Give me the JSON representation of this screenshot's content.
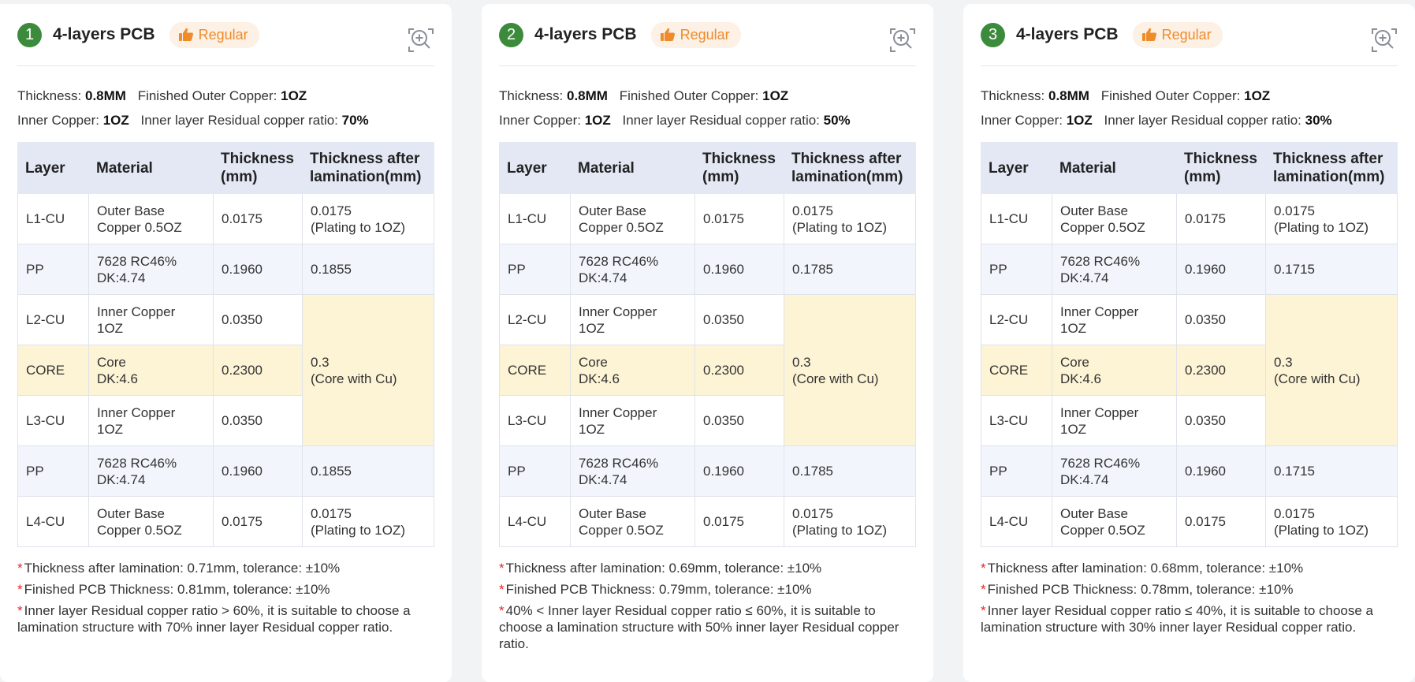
{
  "cards": [
    {
      "number": "1",
      "title": "4-layers PCB",
      "tag": "Regular",
      "specs": {
        "thickness_label": "Thickness:",
        "thickness": "0.8MM",
        "outer_label": "Finished Outer Copper:",
        "outer": "1OZ",
        "inner_label": "Inner Copper:",
        "inner": "1OZ",
        "ratio_label": "Inner layer Residual copper ratio:",
        "ratio": "70%"
      },
      "headers": [
        "Layer",
        "Material",
        "Thickness (mm)",
        "Thickness after lamination(mm)"
      ],
      "rows": [
        {
          "layer": "L1-CU",
          "material": "Outer Base Copper 0.5OZ",
          "thickness": "0.0175",
          "after": "0.0175\n(Plating to 1OZ)"
        },
        {
          "layer": "PP",
          "material": "7628 RC46%\nDK:4.74",
          "thickness": "0.1960",
          "after": "0.1855"
        },
        {
          "layer": "L2-CU",
          "material": "Inner Copper\n1OZ",
          "thickness": "0.0350"
        },
        {
          "layer": "CORE",
          "material": "Core\nDK:4.6",
          "thickness": "0.2300"
        },
        {
          "layer": "L3-CU",
          "material": "Inner Copper\n1OZ",
          "thickness": "0.0350"
        },
        {
          "layer": "PP",
          "material": "7628 RC46%\nDK:4.74",
          "thickness": "0.1960",
          "after": "0.1855"
        },
        {
          "layer": "L4-CU",
          "material": "Outer Base Copper 0.5OZ",
          "thickness": "0.0175",
          "after": "0.0175\n(Plating to 1OZ)"
        }
      ],
      "core_after": "0.3\n(Core with Cu)",
      "notes": [
        "Thickness after lamination: 0.71mm, tolerance: ±10%",
        "Finished PCB Thickness: 0.81mm, tolerance: ±10%",
        "Inner layer Residual copper ratio > 60%, it is suitable to choose a lamination structure with 70% inner layer Residual copper ratio."
      ]
    },
    {
      "number": "2",
      "title": "4-layers PCB",
      "tag": "Regular",
      "specs": {
        "thickness_label": "Thickness:",
        "thickness": "0.8MM",
        "outer_label": "Finished Outer Copper:",
        "outer": "1OZ",
        "inner_label": "Inner Copper:",
        "inner": "1OZ",
        "ratio_label": "Inner layer Residual copper ratio:",
        "ratio": "50%"
      },
      "headers": [
        "Layer",
        "Material",
        "Thickness (mm)",
        "Thickness after lamination(mm)"
      ],
      "rows": [
        {
          "layer": "L1-CU",
          "material": "Outer Base Copper 0.5OZ",
          "thickness": "0.0175",
          "after": "0.0175\n(Plating to 1OZ)"
        },
        {
          "layer": "PP",
          "material": "7628 RC46%\nDK:4.74",
          "thickness": "0.1960",
          "after": "0.1785"
        },
        {
          "layer": "L2-CU",
          "material": "Inner Copper\n1OZ",
          "thickness": "0.0350"
        },
        {
          "layer": "CORE",
          "material": "Core\nDK:4.6",
          "thickness": "0.2300"
        },
        {
          "layer": "L3-CU",
          "material": "Inner Copper\n1OZ",
          "thickness": "0.0350"
        },
        {
          "layer": "PP",
          "material": "7628 RC46%\nDK:4.74",
          "thickness": "0.1960",
          "after": "0.1785"
        },
        {
          "layer": "L4-CU",
          "material": "Outer Base Copper 0.5OZ",
          "thickness": "0.0175",
          "after": "0.0175\n(Plating to 1OZ)"
        }
      ],
      "core_after": "0.3\n(Core with Cu)",
      "notes": [
        "Thickness after lamination: 0.69mm, tolerance: ±10%",
        "Finished PCB Thickness: 0.79mm, tolerance: ±10%",
        "40% < Inner layer Residual copper ratio ≤ 60%, it is suitable to choose a lamination structure with 50% inner layer Residual copper ratio."
      ]
    },
    {
      "number": "3",
      "title": "4-layers PCB",
      "tag": "Regular",
      "specs": {
        "thickness_label": "Thickness:",
        "thickness": "0.8MM",
        "outer_label": "Finished Outer Copper:",
        "outer": "1OZ",
        "inner_label": "Inner Copper:",
        "inner": "1OZ",
        "ratio_label": "Inner layer Residual copper ratio:",
        "ratio": "30%"
      },
      "headers": [
        "Layer",
        "Material",
        "Thickness (mm)",
        "Thickness after lamination(mm)"
      ],
      "rows": [
        {
          "layer": "L1-CU",
          "material": "Outer Base Copper 0.5OZ",
          "thickness": "0.0175",
          "after": "0.0175\n(Plating to 1OZ)"
        },
        {
          "layer": "PP",
          "material": "7628 RC46%\nDK:4.74",
          "thickness": "0.1960",
          "after": "0.1715"
        },
        {
          "layer": "L2-CU",
          "material": "Inner Copper\n1OZ",
          "thickness": "0.0350"
        },
        {
          "layer": "CORE",
          "material": "Core\nDK:4.6",
          "thickness": "0.2300"
        },
        {
          "layer": "L3-CU",
          "material": "Inner Copper\n1OZ",
          "thickness": "0.0350"
        },
        {
          "layer": "PP",
          "material": "7628 RC46%\nDK:4.74",
          "thickness": "0.1960",
          "after": "0.1715"
        },
        {
          "layer": "L4-CU",
          "material": "Outer Base Copper 0.5OZ",
          "thickness": "0.0175",
          "after": "0.0175\n(Plating to 1OZ)"
        }
      ],
      "core_after": "0.3\n(Core with Cu)",
      "notes": [
        "Thickness after lamination: 0.68mm, tolerance: ±10%",
        "Finished PCB Thickness: 0.78mm, tolerance: ±10%",
        "Inner layer Residual copper ratio ≤ 40%, it is suitable to choose a lamination structure with 30% inner layer Residual copper ratio."
      ]
    }
  ],
  "colors": {
    "badge": "#3c8b3c",
    "tag_bg": "#fdf0e4",
    "tag_text": "#ee8c2b",
    "header_bg": "#e3e8f4",
    "core_bg": "#fdf3d5",
    "row_alt_bg": "#f2f6fc",
    "note_star": "#ee2222"
  },
  "icons": {
    "tag": "thumbs-up-icon",
    "zoom": "zoom-in-icon"
  }
}
